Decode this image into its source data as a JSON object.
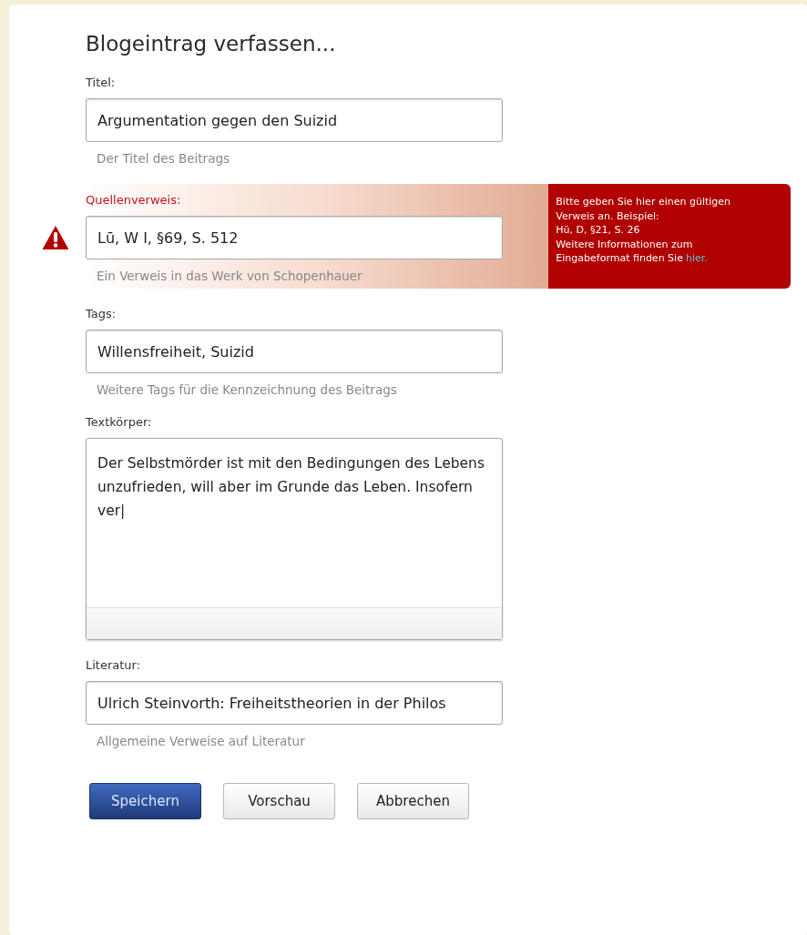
{
  "title": "Blogeintrag verfassen...",
  "fields": [
    {
      "kind": "text",
      "label": "Titel:",
      "value": "Argumentation gegen den Suizid",
      "help": "Der Titel des Beitrags",
      "error": false
    },
    {
      "kind": "text",
      "label": "Quellenverweis:",
      "value": "Lū, W I, §69, S. 512",
      "help": "Ein Verweis in das Werk von Schopenhauer",
      "error": true,
      "message": {
        "lines": [
          "Bitte geben Sie hier einen gültigen",
          "Verweis an. Beispiel:",
          "Hū, D, §21, S.  26",
          "Weitere Informationen zum"
        ],
        "last_line": "Eingabeformat finden Sie",
        "link": "hier."
      }
    },
    {
      "kind": "text",
      "label": "Tags:",
      "value": "Willensfreiheit, Suizid",
      "help": "Weitere Tags für die Kennzeichnung des Beitrags",
      "error": false
    },
    {
      "kind": "textarea",
      "label": "Textkörper:",
      "value": "Der Selbstmörder ist mit den Bedingungen des Lebens unzufrieden, will aber im Grunde das Leben. Insofern ver|",
      "error": false
    },
    {
      "kind": "text",
      "label": "Literatur:",
      "value": "Ulrich Steinvorth: Freiheitstheorien in der Philos",
      "help": "Allgemeine Verweise auf Literatur",
      "error": false
    }
  ],
  "buttons": [
    {
      "label": "Speichern",
      "kind": "primary"
    },
    {
      "label": "Vorschau",
      "kind": "default"
    },
    {
      "label": "Abbrechen",
      "kind": "default"
    }
  ]
}
